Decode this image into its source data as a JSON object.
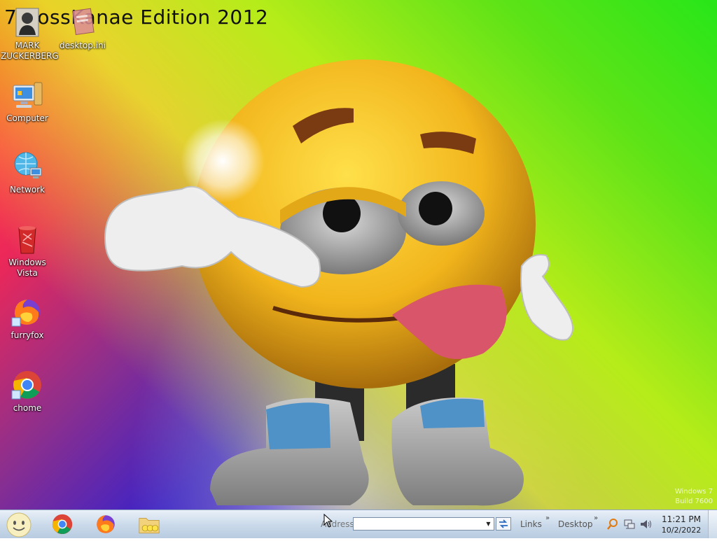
{
  "desktop": {
    "brand": "7 BossKanae Edition 2012",
    "watermark_line1": "Windows 7",
    "watermark_line2": "Build 7600",
    "icons": [
      {
        "label": "MARK ZUCKERBERG",
        "icon": "user-photo-icon"
      },
      {
        "label": "desktop.ini",
        "icon": "ini-file-icon"
      },
      {
        "label": "Computer",
        "icon": "computer-icon"
      },
      {
        "label": "Network",
        "icon": "network-icon"
      },
      {
        "label": "Windows Vista",
        "icon": "recycle-bin-icon"
      },
      {
        "label": "furryfox",
        "icon": "firefox-icon"
      },
      {
        "label": "chome",
        "icon": "chrome-icon"
      }
    ]
  },
  "taskbar": {
    "pinned": [
      "smiley-start-icon",
      "chrome-icon",
      "firefox-icon",
      "folder-icon"
    ],
    "address_label": "Address",
    "address_value": "",
    "links_label": "Links",
    "desktop_label": "Desktop",
    "tray": [
      "search-icon",
      "network-icon",
      "volume-icon"
    ],
    "clock_time": "11:21 PM",
    "clock_date": "10/2/2022"
  },
  "colors": {
    "taskbar_top": "#e9f0f8",
    "taskbar_bottom": "#b8cbe0",
    "smiley_yellow": "#f2c21e",
    "tongue": "#d9566a"
  }
}
